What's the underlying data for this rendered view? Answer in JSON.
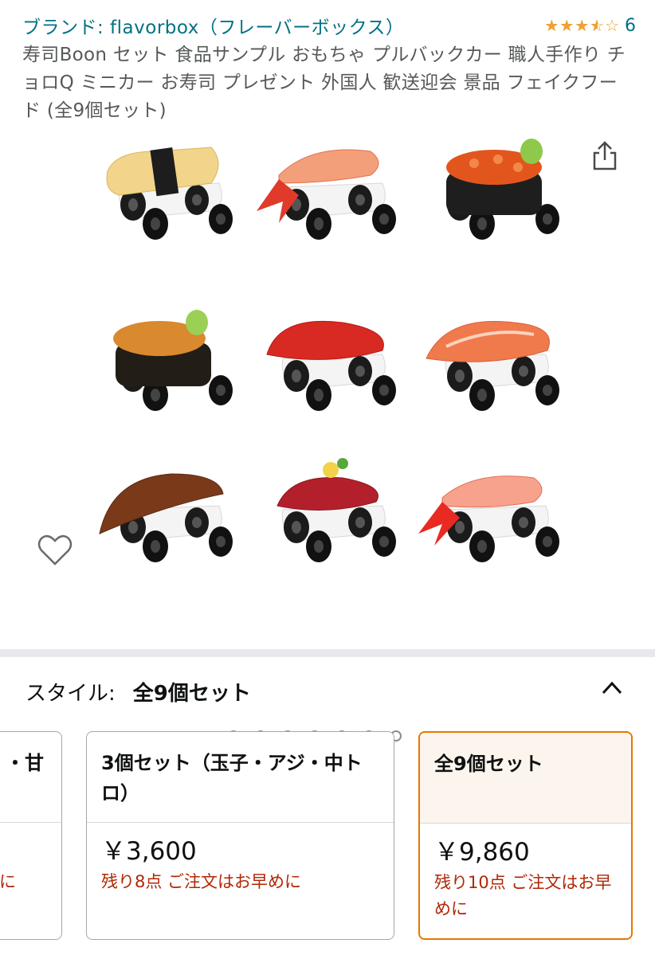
{
  "header": {
    "brand": "ブランド: flavorbox（フレーバーボックス）",
    "rating_value": 3.5,
    "rating_count": "6",
    "title": "寿司Boon セット 食品サンプル おもちゃ プルバックカー 職人手作り チョロQ ミニカー お寿司 プレゼント 外国人 歓送迎会 景品 フェイクフード (全9個セット)"
  },
  "gallery": {
    "icons": [
      "share-icon",
      "heart-icon"
    ],
    "image_count": 7,
    "active_index": 0
  },
  "style": {
    "label": "スタイル:",
    "selected": "全9個セット",
    "collapse_icon": "chevron-up-icon"
  },
  "options": [
    {
      "title": "・甘",
      "price": "",
      "stock": "に"
    },
    {
      "title": "3個セット（玉子・アジ・中トロ）",
      "price": "￥3,600",
      "stock": "残り8点 ご注文はお早めに"
    },
    {
      "title": "全9個セット",
      "price": "￥9,860",
      "stock": "残り10点 ご注文はお早めに"
    }
  ],
  "colors": {
    "link": "#007185",
    "price_alert": "#b12704",
    "selected_border": "#e77600",
    "star": "#f0a034"
  }
}
